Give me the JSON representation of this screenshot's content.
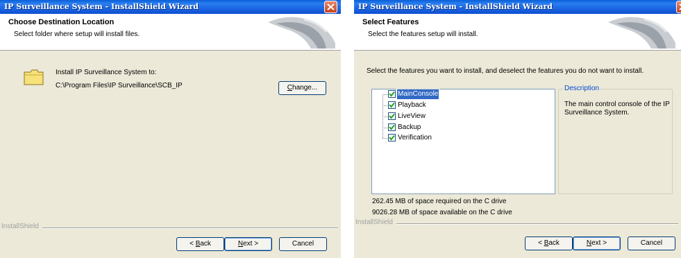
{
  "colors": {
    "title_bar": "#1c66e3",
    "dialog_bg": "#ece9d8",
    "selection": "#316ac5",
    "description_legend": "#0046d5",
    "close_button": "#c6421c"
  },
  "window1": {
    "title": "IP Surveillance System - InstallShield Wizard",
    "header_title": "Choose Destination Location",
    "header_subtitle": "Select folder where setup will install files.",
    "install_label": "Install IP Surveillance System to:",
    "install_path": "C:\\Program Files\\IP Surveillance\\SCB_IP",
    "change_button": {
      "mnemonic": "C",
      "rest": "hange..."
    },
    "brand": "InstallShield",
    "buttons": {
      "back": {
        "prefix": "< ",
        "mnemonic": "B",
        "rest": "ack"
      },
      "next": {
        "mnemonic": "N",
        "rest": "ext >"
      },
      "cancel": "Cancel"
    },
    "icons": {
      "folder": "folder-icon",
      "close": "close-icon",
      "header_graphic": "installshield-header-graphic"
    }
  },
  "window2": {
    "title": "IP Surveillance System - InstallShield Wizard",
    "header_title": "Select Features",
    "header_subtitle": "Select the features setup will install.",
    "instruction": "Select the features you want to install, and deselect the features you do not want to install.",
    "features": [
      {
        "label": "MainConsole",
        "checked": true,
        "selected": true
      },
      {
        "label": "Playback",
        "checked": true,
        "selected": false
      },
      {
        "label": "LiveView",
        "checked": true,
        "selected": false
      },
      {
        "label": "Backup",
        "checked": true,
        "selected": false
      },
      {
        "label": "Verification",
        "checked": true,
        "selected": false
      }
    ],
    "description_title": "Description",
    "description_text": "The main control console of the IP Surveillance System.",
    "space_required": "262.45 MB of space required on the C drive",
    "space_available": "9026.28 MB of space available on the C drive",
    "brand": "InstallShield",
    "buttons": {
      "back": {
        "prefix": "< ",
        "mnemonic": "B",
        "rest": "ack"
      },
      "next": {
        "mnemonic": "N",
        "rest": "ext >"
      },
      "cancel": "Cancel"
    }
  }
}
